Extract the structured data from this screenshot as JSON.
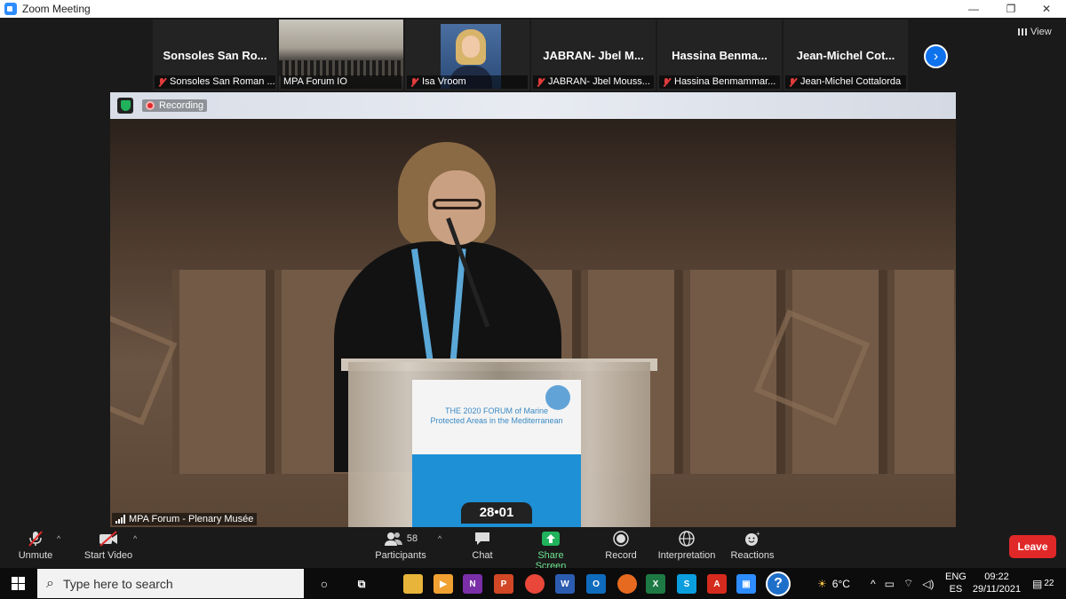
{
  "window": {
    "title": "Zoom Meeting",
    "minimize": "—",
    "restore": "❐",
    "close": "✕"
  },
  "participants_strip": [
    {
      "big_name": "Sonsoles San Ro...",
      "caption": "Sonsoles San Roman ...",
      "muted": true
    },
    {
      "big_name": "",
      "caption": "MPA Forum IO",
      "muted": false
    },
    {
      "big_name": "",
      "caption": "Isa Vroom",
      "muted": true
    },
    {
      "big_name": "JABRAN- Jbel M...",
      "caption": "JABRAN- Jbel Mouss...",
      "muted": true
    },
    {
      "big_name": "Hassina Benma...",
      "caption": "Hassina Benmammar...",
      "muted": true
    },
    {
      "big_name": "Jean-Michel Cot...",
      "caption": "Jean-Michel Cottalorda",
      "muted": true
    }
  ],
  "view_label": "View",
  "next_icon": "chevron-right-icon",
  "main_video": {
    "recording_label": "Recording",
    "name_label": "MPA Forum - Plenary Musée",
    "poster_title": "THE 2020 FORUM of Marine Protected Areas in the Mediterranean",
    "poster_date": "28•01"
  },
  "toolbar": {
    "unmute": "Unmute",
    "start_video": "Start Video",
    "participants": "Participants",
    "participants_count": "58",
    "chat": "Chat",
    "share_screen": "Share Screen",
    "record": "Record",
    "interpretation": "Interpretation",
    "reactions": "Reactions",
    "leave": "Leave"
  },
  "taskbar": {
    "search_placeholder": "Type here to search",
    "weather": "6°C",
    "lang_top": "ENG",
    "lang_bottom": "ES",
    "time": "09:22",
    "date": "29/11/2021",
    "notifications": "22"
  },
  "colors": {
    "zoom_blue": "#0e72ed",
    "leave_red": "#e02828",
    "share_green": "#21b35b"
  }
}
